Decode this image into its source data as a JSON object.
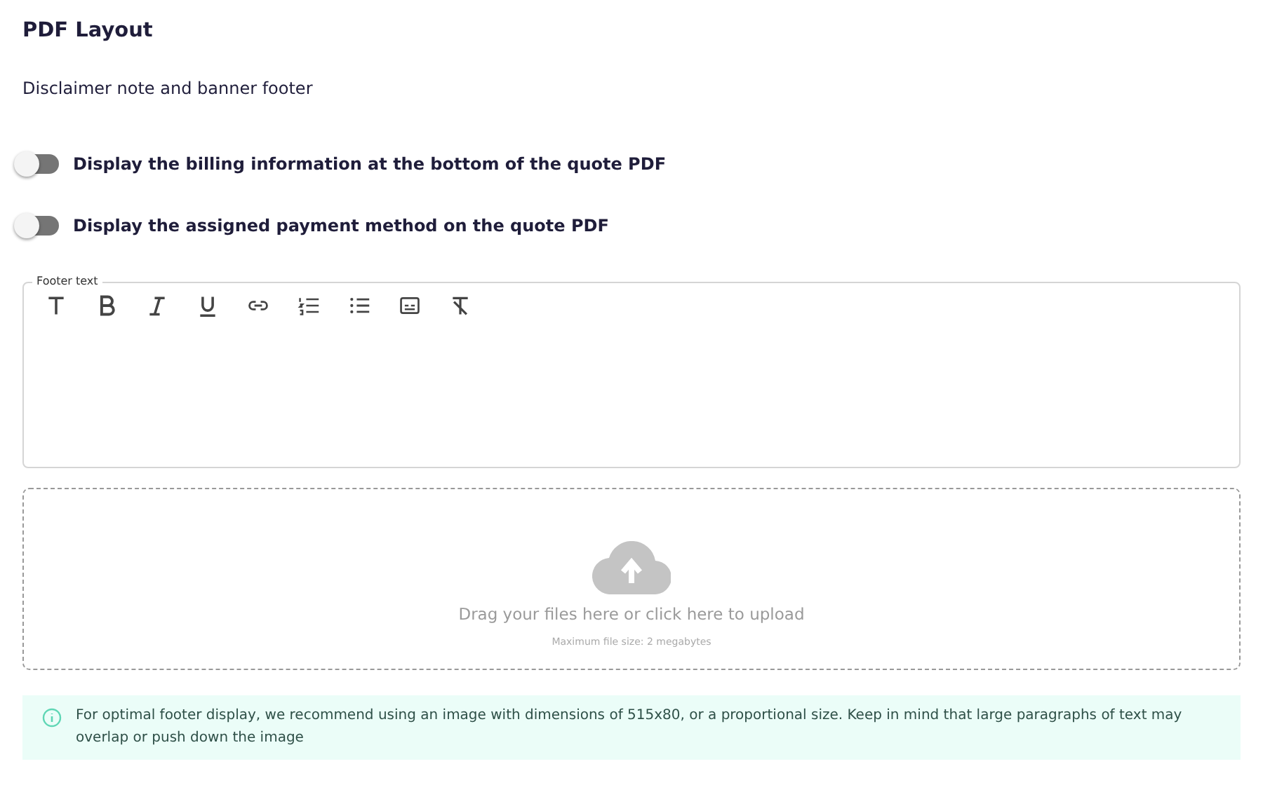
{
  "title": "PDF Layout",
  "subtitle": "Disclaimer note and banner footer",
  "toggles": [
    {
      "label": "Display the billing information at the bottom of the quote PDF",
      "on": false
    },
    {
      "label": "Display the assigned payment method on the quote PDF",
      "on": false
    }
  ],
  "editor": {
    "legend": "Footer text",
    "tools": [
      {
        "kind": "heading"
      },
      {
        "kind": "bold"
      },
      {
        "kind": "italic"
      },
      {
        "kind": "underline"
      },
      {
        "kind": "link"
      },
      {
        "kind": "ordered-list"
      },
      {
        "kind": "bullet-list"
      },
      {
        "kind": "embed"
      },
      {
        "kind": "clear-format"
      }
    ]
  },
  "upload": {
    "text": "Drag your files here or click here to upload",
    "hint": "Maximum file size: 2 megabytes"
  },
  "info": "For optimal footer display, we recommend using an image with dimensions of 515x80, or a proportional size. Keep in mind that large paragraphs of text may overlap or push down the image"
}
